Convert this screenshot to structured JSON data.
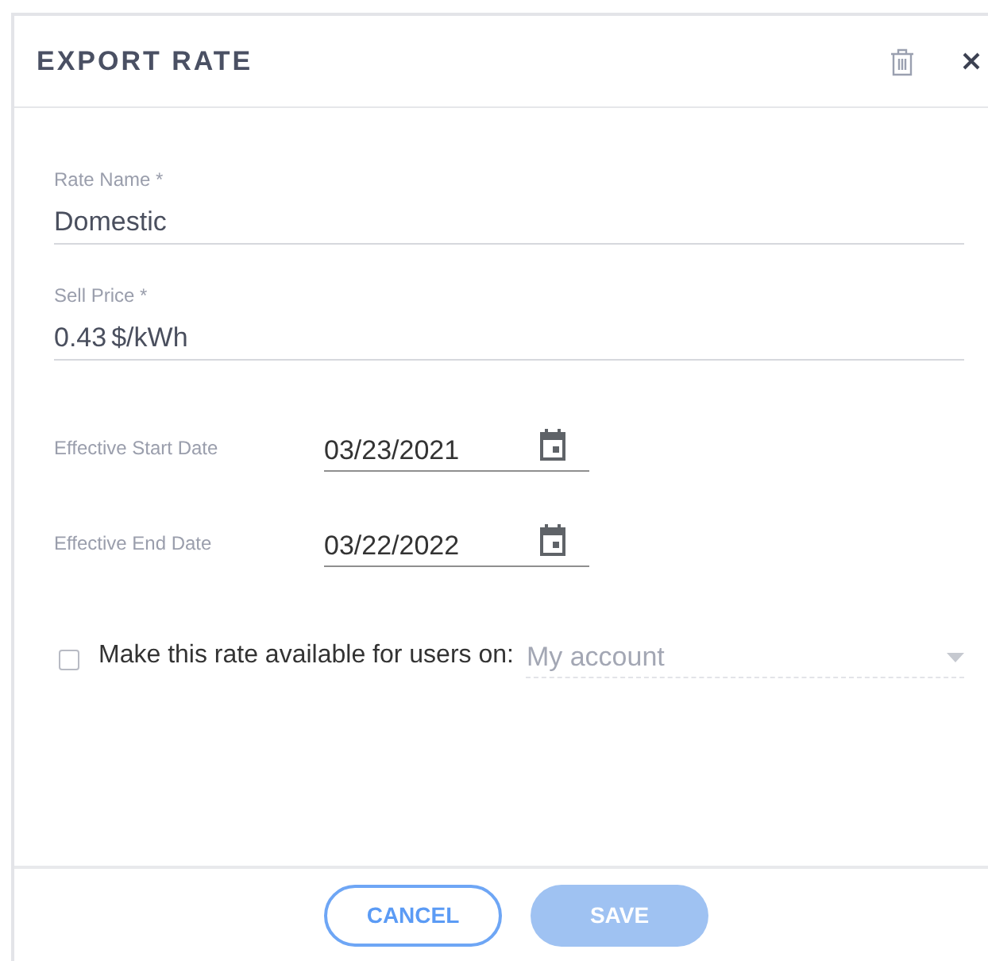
{
  "dialog": {
    "title": "EXPORT RATE"
  },
  "fields": [
    {
      "label": "Rate Name *",
      "value": "Domestic"
    },
    {
      "label": "Sell Price *",
      "value": "0.43",
      "unit": "$/kWh"
    }
  ],
  "dates": [
    {
      "label": "Effective Start Date",
      "value": "03/23/2021"
    },
    {
      "label": "Effective End Date",
      "value": "03/22/2022"
    }
  ],
  "availability": {
    "label": "Make this rate available for users on:",
    "checked": false,
    "select": {
      "value": "My account",
      "disabled": true
    }
  },
  "buttons": [
    {
      "label": "CANCEL",
      "kind": "outline",
      "disabled": false
    },
    {
      "label": "SAVE",
      "kind": "primary",
      "disabled": true
    }
  ]
}
